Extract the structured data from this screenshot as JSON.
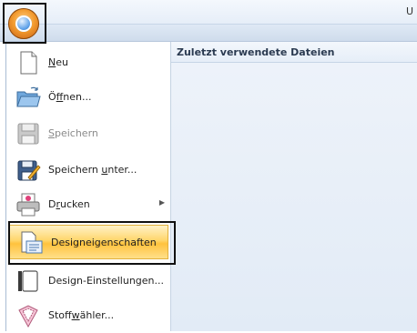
{
  "titlebar": {
    "trailing_text": "U"
  },
  "menu": {
    "items": [
      {
        "label": "Neu",
        "accelerator": "N",
        "icon": "new-document-icon"
      },
      {
        "label": "Öffnen...",
        "accelerator": "f",
        "icon": "open-folder-icon"
      },
      {
        "label": "Speichern",
        "accelerator": "S",
        "icon": "save-disk-icon",
        "state": "disabled"
      },
      {
        "label": "Speichern unter...",
        "accelerator": "u",
        "icon": "save-as-icon"
      },
      {
        "label": "Drucken",
        "accelerator": "r",
        "icon": "printer-icon",
        "has_submenu": true
      },
      {
        "label": "Designeigenschaften",
        "icon": "design-properties-icon",
        "state": "highlighted"
      },
      {
        "label": "Design-Einstellungen...",
        "icon": "design-settings-icon"
      },
      {
        "label": "Stoffwähler...",
        "accelerator": "w",
        "icon": "fabric-selector-icon"
      }
    ]
  },
  "recent_files": {
    "header": "Zuletzt verwendete Dateien"
  },
  "colors": {
    "highlight": "#ffc23d",
    "panel_bg": "#e2ebf6",
    "border": "#a9bcd4"
  }
}
